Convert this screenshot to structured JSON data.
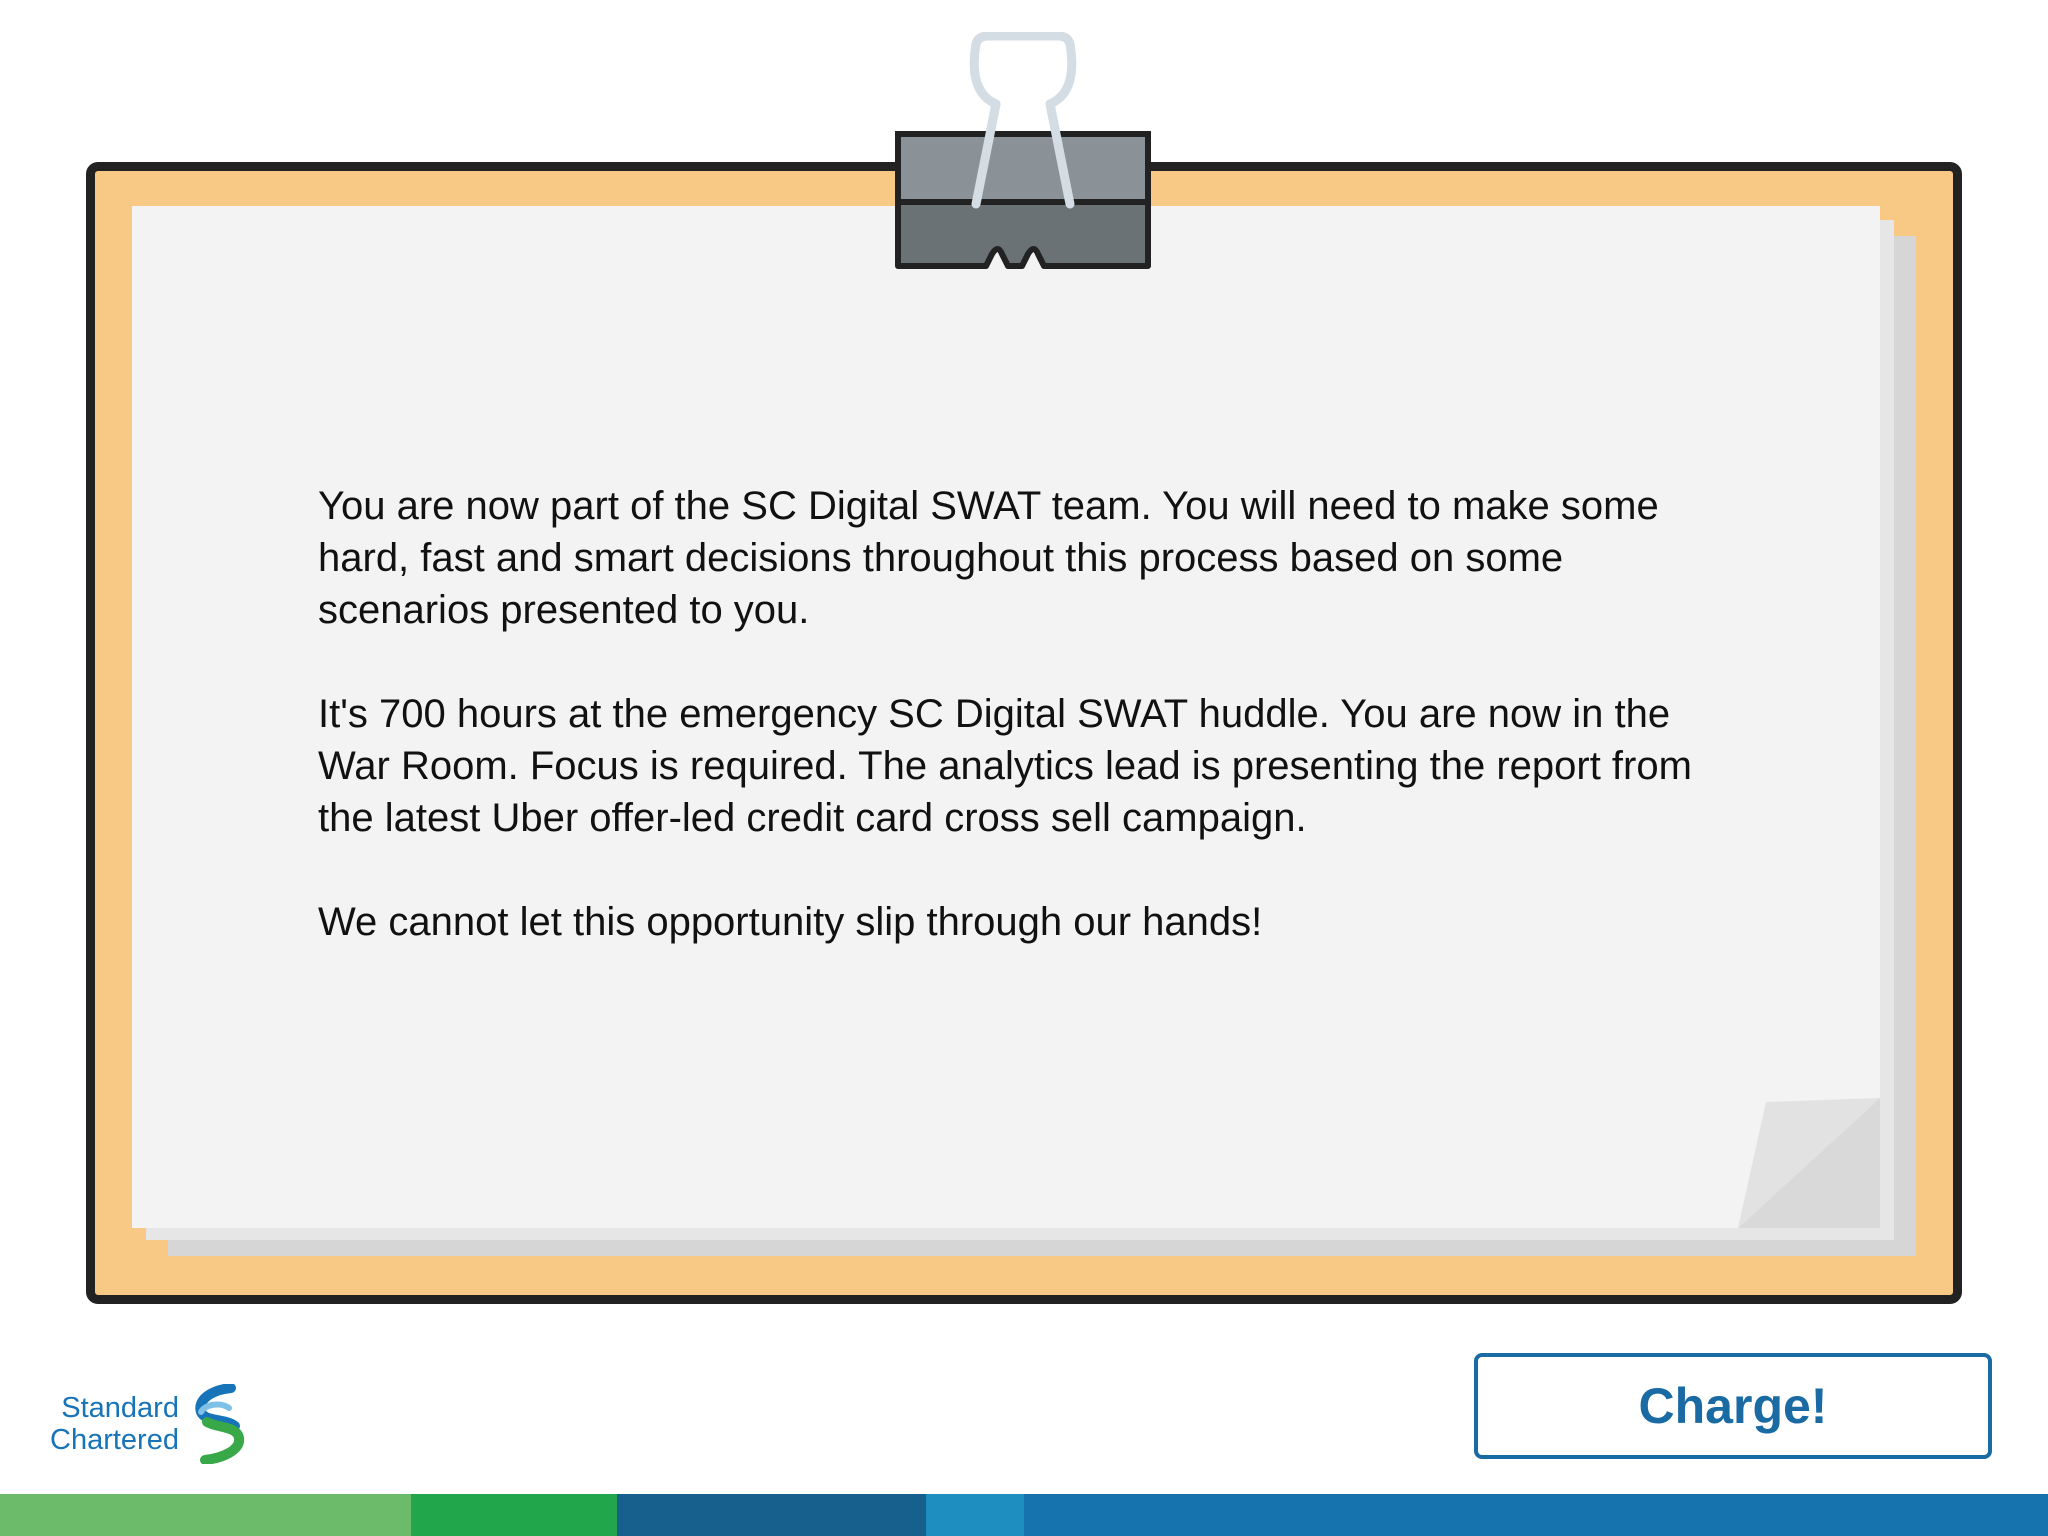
{
  "message": {
    "paragraph_1": "You are now part of the SC Digital SWAT team. You will need to make some hard, fast and smart decisions throughout this process based on some scenarios presented to you.",
    "paragraph_2": "It's 700 hours at the emergency SC Digital SWAT huddle. You are now in the War Room. Focus is required. The analytics lead is presenting the report from the latest Uber offer-led credit card cross sell campaign.",
    "paragraph_3": "We cannot let this opportunity slip through our hands!"
  },
  "logo": {
    "line_1": "Standard",
    "line_2": "Chartered"
  },
  "actions": {
    "charge_label": "Charge!"
  },
  "colors": {
    "board": "#f8c885",
    "board_border": "#222222",
    "paper": "#f3f3f3",
    "accent_blue": "#1a6aa4",
    "logo_blue": "#1874b8",
    "logo_green": "#38a849",
    "bar_segments": [
      "#6cbb6a",
      "#22a64b",
      "#175f8c",
      "#1e8dbf",
      "#1773ad"
    ]
  },
  "icons": {
    "clip": "binder-clip-icon",
    "logo_mark": "standard-chartered-logo-icon"
  }
}
